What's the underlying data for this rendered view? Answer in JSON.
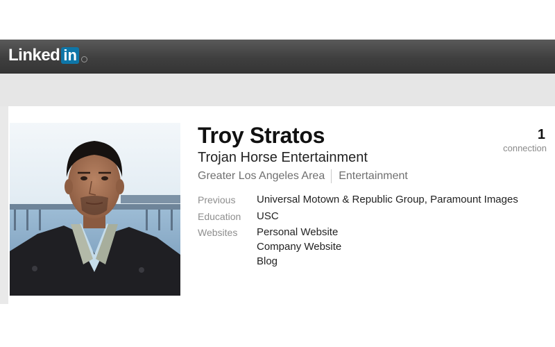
{
  "brand": {
    "linked": "Linked",
    "in": "in"
  },
  "profile": {
    "name": "Troy Stratos",
    "headline": "Trojan Horse Entertainment",
    "location": "Greater Los Angeles Area",
    "industry": "Entertainment",
    "connections": {
      "count": "1",
      "label": "connection"
    }
  },
  "details": {
    "previous": {
      "label": "Previous",
      "value": "Universal Motown & Republic Group, Paramount Images"
    },
    "education": {
      "label": "Education",
      "value": "USC"
    },
    "websites": {
      "label": "Websites",
      "items": [
        "Personal Website",
        "Company Website",
        "Blog"
      ]
    }
  },
  "colors": {
    "brand_blue": "#0e76a8",
    "topbar": "#3f3f3f",
    "background": "#e6e6e6",
    "label_gray": "#8e8e8e"
  }
}
